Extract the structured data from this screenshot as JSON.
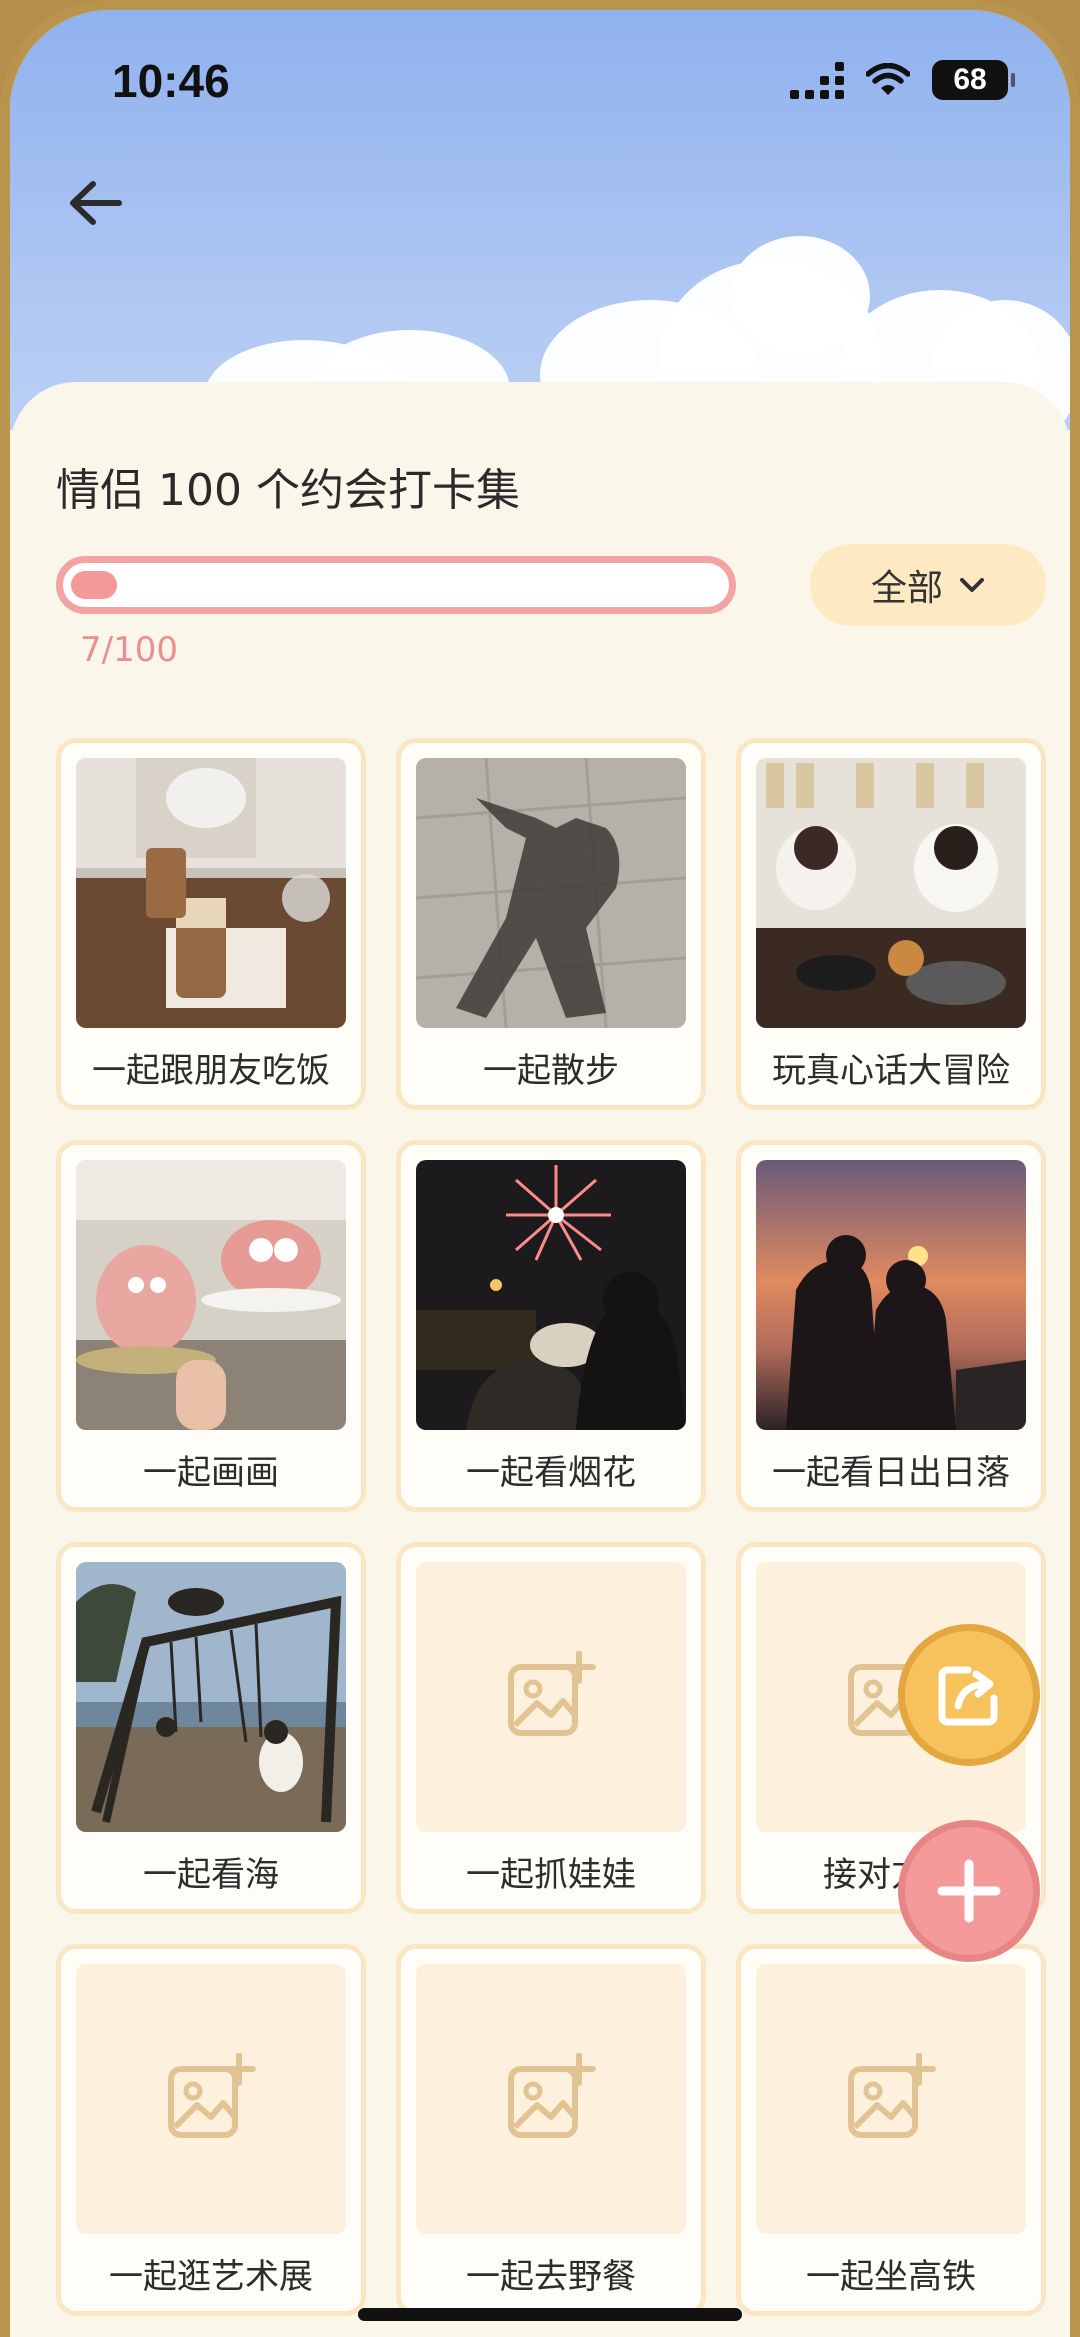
{
  "status_bar": {
    "time": "10:46",
    "battery": "68"
  },
  "header": {
    "back_icon": "arrow-left-icon"
  },
  "page": {
    "title": "情侣 100 个约会打卡集",
    "progress_text": "7/100",
    "progress_value": 0.07,
    "filter_label": "全部"
  },
  "colors": {
    "accent_pink": "#f49898",
    "accent_gold": "#f7c15c",
    "card_border": "#fbe6c3",
    "background": "#fbf6ea"
  },
  "items": [
    {
      "label": "一起跟朋友吃饭",
      "has_photo": true,
      "photo": "cafe-drinks"
    },
    {
      "label": "一起散步",
      "has_photo": true,
      "photo": "shadow-walk"
    },
    {
      "label": "玩真心话大冒险",
      "has_photo": true,
      "photo": "restaurant-friends"
    },
    {
      "label": "一起画画",
      "has_photo": true,
      "photo": "clay-figures"
    },
    {
      "label": "一起看烟花",
      "has_photo": true,
      "photo": "fireworks"
    },
    {
      "label": "一起看日出日落",
      "has_photo": true,
      "photo": "sunset-silhouette"
    },
    {
      "label": "一起看海",
      "has_photo": true,
      "photo": "beach-swings"
    },
    {
      "label": "一起抓娃娃",
      "has_photo": false
    },
    {
      "label": "接对方下",
      "has_photo": false
    },
    {
      "label": "一起逛艺术展",
      "has_photo": false
    },
    {
      "label": "一起去野餐",
      "has_photo": false
    },
    {
      "label": "一起坐高铁",
      "has_photo": false
    }
  ],
  "actions": {
    "share_icon": "share-icon",
    "add_icon": "plus-icon"
  }
}
